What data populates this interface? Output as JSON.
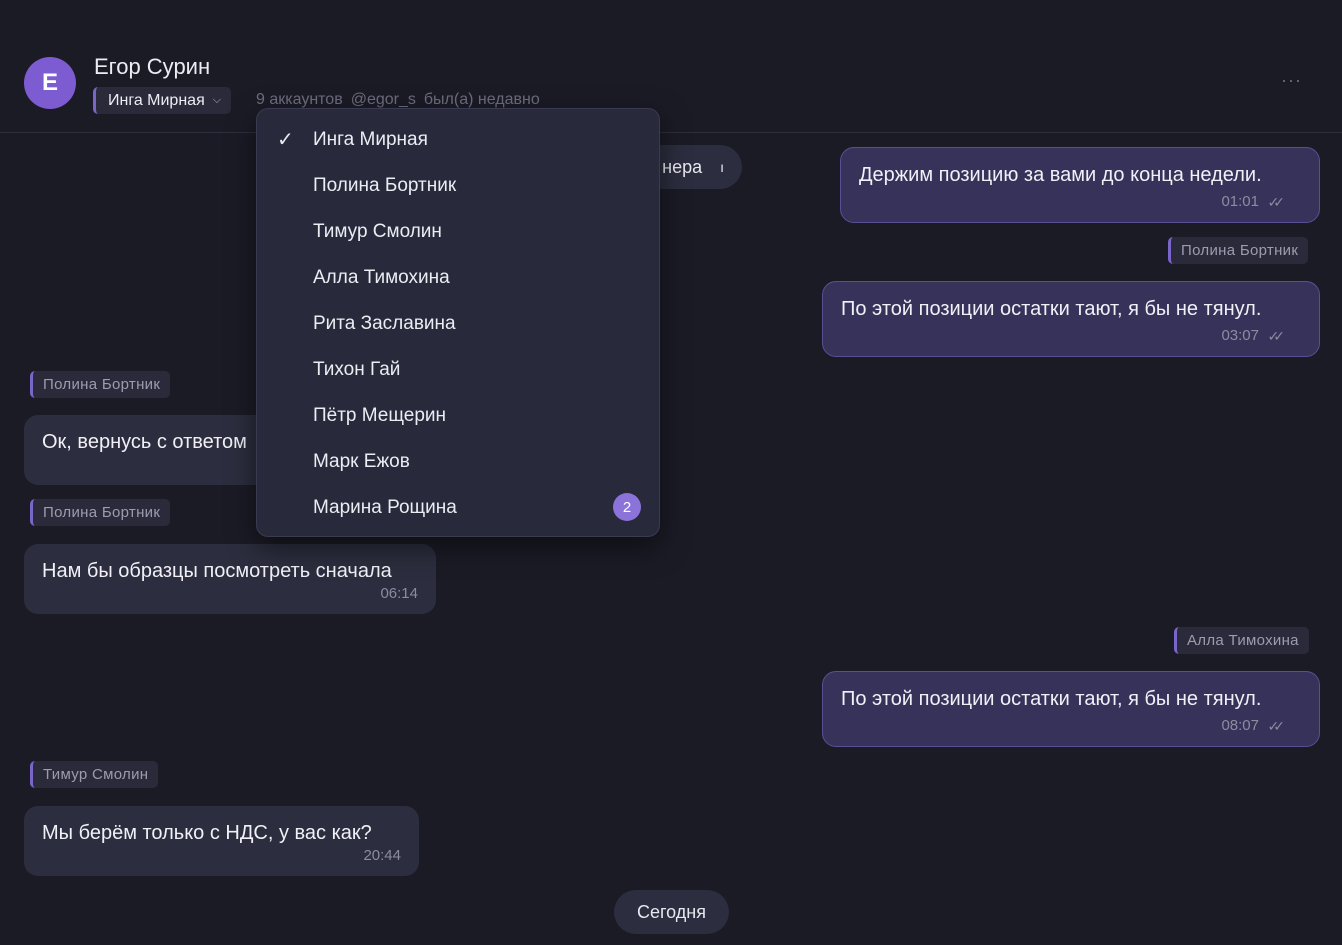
{
  "header": {
    "avatar_letter": "Е",
    "contact_name": "Егор Сурин",
    "selected_account": "Инга Мирная",
    "accounts_count": "9 аккаунтов",
    "username": "@egor_s",
    "last_seen": "был(а) недавно",
    "more": "···"
  },
  "dropdown": {
    "items": [
      {
        "label": "Инга Мирная",
        "checked": true
      },
      {
        "label": "Полина Бортник"
      },
      {
        "label": "Тимур Смолин"
      },
      {
        "label": "Алла Тимохина"
      },
      {
        "label": "Рита Заславина"
      },
      {
        "label": "Тихон Гай"
      },
      {
        "label": "Пётр Мещерин"
      },
      {
        "label": "Марк Ежов"
      },
      {
        "label": "Марина Рощина",
        "badge": "2"
      }
    ]
  },
  "date_pills": {
    "yesterday_partial": "нера",
    "today": "Сегодня"
  },
  "messages": [
    {
      "text": "Держим позицию за вами до конца недели.",
      "time": "01:01",
      "status": "✓✓"
    },
    {
      "account": "Полина Бортник",
      "text": "По этой позиции остатки тают, я бы не тянул.",
      "time": "03:07",
      "status": "✓✓"
    },
    {
      "account": "Полина Бортник",
      "text": "Ок, вернусь с ответом"
    },
    {
      "account": "Полина Бортник",
      "text": "Нам бы образцы посмотреть сначала",
      "time": "06:14"
    },
    {
      "account": "Алла Тимохина",
      "text": "По этой позиции остатки тают, я бы не тянул.",
      "time": "08:07",
      "status": "✓✓"
    },
    {
      "account": "Тимур Смолин",
      "text": "Мы берём только с НДС, у вас как?",
      "time": "20:44"
    }
  ],
  "colors": {
    "background": "#1b1b26",
    "accent": "#7d5bd1",
    "incoming_bubble": "#2c2d3e",
    "outgoing_bubble": "#37325a",
    "badge": "#8b73d9"
  }
}
